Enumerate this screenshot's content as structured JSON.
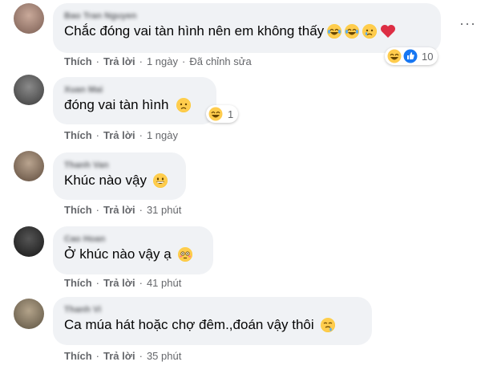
{
  "comments": [
    {
      "name": "Bao Tran Nguyen",
      "text": "Chắc đóng vai tàn hình nên em không thấy",
      "emojis": [
        "laugh-cry-emoji",
        "laugh-cry-emoji",
        "crying-emoji",
        "heart-emoji"
      ],
      "like_label": "Thích",
      "reply_label": "Trả lời",
      "time": "1 ngày",
      "edited": "Đã chỉnh sửa",
      "reaction_count": "10"
    },
    {
      "name": "Xuan Mai",
      "text": "đóng vai tàn hình",
      "emojis": [
        "sad-face-emoji"
      ],
      "like_label": "Thích",
      "reply_label": "Trả lời",
      "time": "1 ngày",
      "reaction_count": "1"
    },
    {
      "name": "Thanh Van",
      "text": "Khúc nào vậy",
      "emojis": [
        "grinning-face-emoji"
      ],
      "like_label": "Thích",
      "reply_label": "Trả lời",
      "time": "31 phút"
    },
    {
      "name": "Cao Hoan",
      "text": "Ở khúc nào vậy ạ",
      "emojis": [
        "flushed-face-emoji"
      ],
      "like_label": "Thích",
      "reply_label": "Trả lời",
      "time": "41 phút"
    },
    {
      "name": "Thanh Vi",
      "text": "Ca múa hát hoặc chợ đêm.,đoán vậy thôi",
      "emojis": [
        "drooling-face-emoji"
      ],
      "like_label": "Thích",
      "reply_label": "Trả lời",
      "time": "35 phút"
    }
  ],
  "more_options": "···",
  "dot": "·",
  "colors": {
    "bubble_bg": "#f0f2f5",
    "meta_text": "#65676b",
    "like_blue": "#1877f2",
    "heart_red": "#f33e58"
  }
}
